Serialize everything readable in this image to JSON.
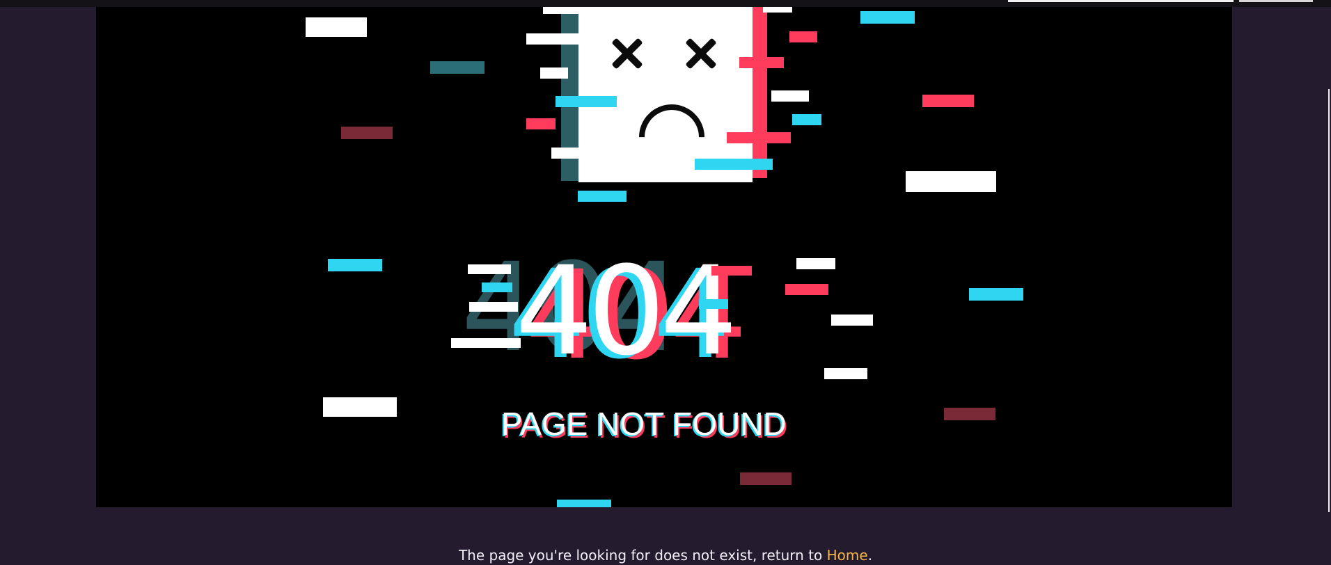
{
  "hero": {
    "code": "404",
    "subtitle": "PAGE NOT FOUND"
  },
  "message": {
    "text_before": "The page you're looking for does not exist, return to ",
    "home_link": "Home",
    "text_after": "."
  },
  "colors": {
    "page_background": "#241c2e",
    "hero_background": "#000000",
    "glitch_cyan": "#2ed6f2",
    "glitch_red": "#ff3c5c",
    "glitch_teal": "#2c6e78",
    "link": "#f4b446"
  }
}
